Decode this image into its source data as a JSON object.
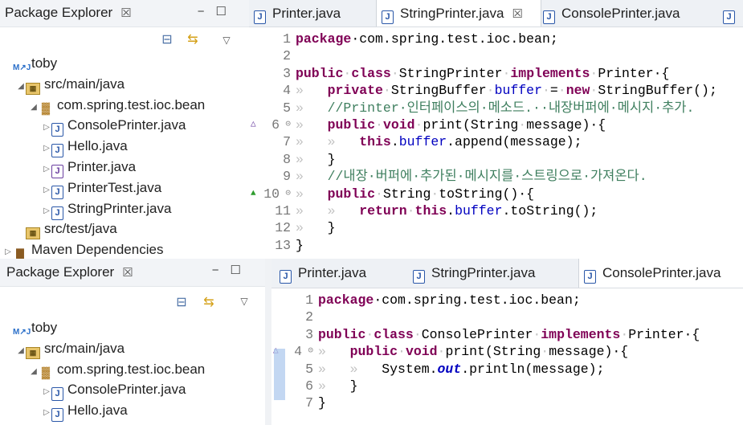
{
  "top": {
    "explorer": {
      "title": "Package Explorer",
      "close": "☒",
      "minmax": "−☐",
      "tree": [
        {
          "indent": 0,
          "twisty": "",
          "icon": "ic-proj",
          "glyph": "M↗J",
          "label": "toby"
        },
        {
          "indent": 1,
          "twisty": "◢",
          "icon": "ic-src",
          "glyph": "▦",
          "label": "src/main/java"
        },
        {
          "indent": 2,
          "twisty": "◢",
          "icon": "ic-pkg",
          "glyph": "▓",
          "label": "com.spring.test.ioc.bean"
        },
        {
          "indent": 3,
          "twisty": "▷",
          "icon": "ic-java",
          "glyph": "J",
          "label": "ConsolePrinter.java"
        },
        {
          "indent": 3,
          "twisty": "▷",
          "icon": "ic-java",
          "glyph": "J",
          "label": "Hello.java"
        },
        {
          "indent": 3,
          "twisty": "▷",
          "icon": "ic-iface",
          "glyph": "J",
          "label": "Printer.java"
        },
        {
          "indent": 3,
          "twisty": "▷",
          "icon": "ic-java",
          "glyph": "J",
          "label": "PrinterTest.java"
        },
        {
          "indent": 3,
          "twisty": "▷",
          "icon": "ic-java",
          "glyph": "J",
          "label": "StringPrinter.java"
        },
        {
          "indent": 1,
          "twisty": "",
          "icon": "ic-src",
          "glyph": "▦",
          "label": "src/test/java"
        },
        {
          "indent": 0,
          "twisty": "▷",
          "icon": "ic-lib",
          "glyph": "▇",
          "label": "Maven Dependencies"
        }
      ]
    },
    "editor": {
      "tabs": [
        {
          "label": "Printer.java",
          "active": false
        },
        {
          "label": "StringPrinter.java",
          "active": true,
          "close": "☒"
        },
        {
          "label": "ConsolePrinter.java",
          "active": false
        }
      ],
      "lines": [
        {
          "n": "1",
          "tokens": [
            [
              "kw",
              "package"
            ],
            [
              "",
              "·com.spring.test.ioc.bean;"
            ]
          ]
        },
        {
          "n": "2",
          "tokens": []
        },
        {
          "n": "3",
          "tokens": [
            [
              "kw",
              "public"
            ],
            [
              "ws",
              "·"
            ],
            [
              "kw",
              "class"
            ],
            [
              "ws",
              "·"
            ],
            [
              "",
              "StringPrinter"
            ],
            [
              "ws",
              "·"
            ],
            [
              "kw",
              "implements"
            ],
            [
              "ws",
              "·"
            ],
            [
              "",
              "Printer·{"
            ]
          ]
        },
        {
          "n": "4",
          "tokens": [
            [
              "ws",
              "»   "
            ],
            [
              "kw",
              "private"
            ],
            [
              "ws",
              "·"
            ],
            [
              "",
              "StringBuffer"
            ],
            [
              "ws",
              "·"
            ],
            [
              "fd",
              "buffer"
            ],
            [
              "ws",
              "·"
            ],
            [
              "",
              "="
            ],
            [
              "ws",
              "·"
            ],
            [
              "kw",
              "new"
            ],
            [
              "ws",
              "·"
            ],
            [
              "",
              "StringBuffer();"
            ]
          ]
        },
        {
          "n": "5",
          "tokens": [
            [
              "ws",
              "»   "
            ],
            [
              "cm",
              "//Printer·인터페이스의·메소드.··내장버퍼에·메시지·추가."
            ]
          ]
        },
        {
          "n": "6",
          "mark": "△",
          "fold": "⊝",
          "tokens": [
            [
              "ws",
              "»   "
            ],
            [
              "kw",
              "public"
            ],
            [
              "ws",
              "·"
            ],
            [
              "kw",
              "void"
            ],
            [
              "ws",
              "·"
            ],
            [
              "",
              "print(String"
            ],
            [
              "ws",
              "·"
            ],
            [
              "",
              "message)·{"
            ]
          ]
        },
        {
          "n": "7",
          "tokens": [
            [
              "ws",
              "»   »   "
            ],
            [
              "kw",
              "this"
            ],
            [
              "",
              "."
            ],
            [
              "fd",
              "buffer"
            ],
            [
              "",
              ".append(message);"
            ]
          ]
        },
        {
          "n": "8",
          "tokens": [
            [
              "ws",
              "»   "
            ],
            [
              "",
              "}"
            ]
          ]
        },
        {
          "n": "9",
          "tokens": [
            [
              "ws",
              "»   "
            ],
            [
              "cm",
              "//내장·버퍼에·추가된·메시지를·스트링으로·가져온다."
            ]
          ]
        },
        {
          "n": "10",
          "mark": "▲",
          "fold": "⊝",
          "tokens": [
            [
              "ws",
              "»   "
            ],
            [
              "kw",
              "public"
            ],
            [
              "ws",
              "·"
            ],
            [
              "",
              "String"
            ],
            [
              "ws",
              "·"
            ],
            [
              "",
              "toString()·{"
            ]
          ]
        },
        {
          "n": "11",
          "tokens": [
            [
              "ws",
              "»   »   "
            ],
            [
              "kw",
              "return"
            ],
            [
              "ws",
              "·"
            ],
            [
              "kw",
              "this"
            ],
            [
              "",
              "."
            ],
            [
              "fd",
              "buffer"
            ],
            [
              "",
              ".toString();"
            ]
          ]
        },
        {
          "n": "12",
          "tokens": [
            [
              "ws",
              "»   "
            ],
            [
              "",
              "}"
            ]
          ]
        },
        {
          "n": "13",
          "tokens": [
            [
              "",
              "}"
            ]
          ]
        }
      ]
    }
  },
  "bottom": {
    "explorer": {
      "title": "Package Explorer",
      "close": "☒",
      "minmax": "−☐",
      "tree": [
        {
          "indent": 0,
          "twisty": "",
          "icon": "ic-proj",
          "glyph": "M↗J",
          "label": "toby"
        },
        {
          "indent": 1,
          "twisty": "◢",
          "icon": "ic-src",
          "glyph": "▦",
          "label": "src/main/java"
        },
        {
          "indent": 2,
          "twisty": "◢",
          "icon": "ic-pkg",
          "glyph": "▓",
          "label": "com.spring.test.ioc.bean"
        },
        {
          "indent": 3,
          "twisty": "▷",
          "icon": "ic-java",
          "glyph": "J",
          "label": "ConsolePrinter.java"
        },
        {
          "indent": 3,
          "twisty": "▷",
          "icon": "ic-java",
          "glyph": "J",
          "label": "Hello.java"
        }
      ]
    },
    "editor": {
      "tabs": [
        {
          "label": "Printer.java",
          "active": false
        },
        {
          "label": "StringPrinter.java",
          "active": false
        },
        {
          "label": "ConsolePrinter.java",
          "active": true
        }
      ],
      "lines": [
        {
          "n": "1",
          "tokens": [
            [
              "kw",
              "package"
            ],
            [
              "",
              "·com.spring.test.ioc.bean;"
            ]
          ]
        },
        {
          "n": "2",
          "tokens": []
        },
        {
          "n": "3",
          "tokens": [
            [
              "kw",
              "public"
            ],
            [
              "ws",
              "·"
            ],
            [
              "kw",
              "class"
            ],
            [
              "ws",
              "·"
            ],
            [
              "",
              "ConsolePrinter"
            ],
            [
              "ws",
              "·"
            ],
            [
              "kw",
              "implements"
            ],
            [
              "ws",
              "·"
            ],
            [
              "",
              "Printer·{"
            ]
          ]
        },
        {
          "n": "4",
          "mark": "△",
          "fold": "⊝",
          "tokens": [
            [
              "ws",
              "»   "
            ],
            [
              "kw",
              "public"
            ],
            [
              "ws",
              "·"
            ],
            [
              "kw",
              "void"
            ],
            [
              "ws",
              "·"
            ],
            [
              "",
              "print(String"
            ],
            [
              "ws",
              "·"
            ],
            [
              "",
              "message)·{"
            ]
          ]
        },
        {
          "n": "5",
          "tokens": [
            [
              "ws",
              "»   »   "
            ],
            [
              "",
              "System."
            ],
            [
              "sf",
              "out"
            ],
            [
              "",
              ".println(message);"
            ]
          ]
        },
        {
          "n": "6",
          "tokens": [
            [
              "ws",
              "»   "
            ],
            [
              "",
              "}"
            ]
          ]
        },
        {
          "n": "7",
          "tokens": [
            [
              "",
              "}"
            ]
          ]
        }
      ]
    }
  }
}
